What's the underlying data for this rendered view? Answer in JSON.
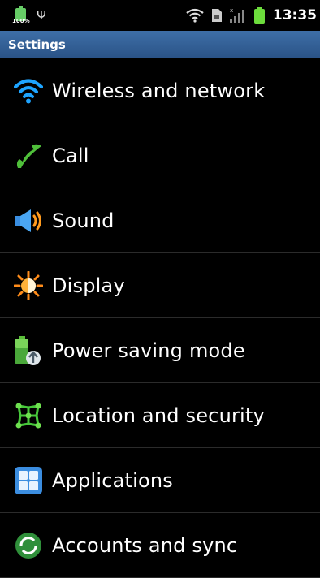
{
  "status_bar": {
    "battery_percent": "100%",
    "time": "13:35",
    "icons": [
      "battery-icon",
      "usb-icon",
      "wifi-icon",
      "sim-icon",
      "signal-icon",
      "battery-icon"
    ]
  },
  "header": {
    "title": "Settings",
    "color": "#3e6fa8"
  },
  "settings_items": [
    {
      "label": "Wireless and network",
      "icon": "wifi-icon"
    },
    {
      "label": "Call",
      "icon": "phone-icon"
    },
    {
      "label": "Sound",
      "icon": "speaker-icon"
    },
    {
      "label": "Display",
      "icon": "sun-icon"
    },
    {
      "label": "Power saving mode",
      "icon": "battery-recycle-icon"
    },
    {
      "label": "Location and security",
      "icon": "location-grid-icon"
    },
    {
      "label": "Applications",
      "icon": "apps-grid-icon"
    },
    {
      "label": "Accounts and sync",
      "icon": "sync-icon"
    }
  ]
}
